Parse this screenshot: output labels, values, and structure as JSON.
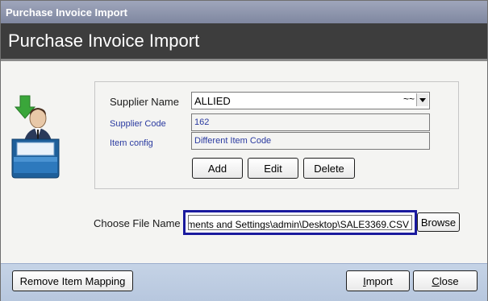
{
  "window": {
    "title": "Purchase Invoice Import"
  },
  "banner": {
    "heading": "Purchase Invoice Import"
  },
  "supplier": {
    "name_label": "Supplier Name",
    "name_value": "ALLIED",
    "name_suffix": "~~",
    "code_label": "Supplier Code",
    "code_value": "162",
    "item_config_label": "Item config",
    "item_config_value": "Different Item Code"
  },
  "actions": {
    "add_label": "Add",
    "edit_label": "Edit",
    "delete_label": "Delete"
  },
  "file": {
    "label": "Choose File Name",
    "path_visible": "ments and Settings\\admin\\Desktop\\SALE3369.CSV",
    "browse_label": "Browse"
  },
  "footer": {
    "remove_mapping_label": "Remove Item Mapping",
    "import_prefix": "I",
    "import_rest": "mport",
    "close_prefix": "C",
    "close_rest": "lose"
  },
  "icons": {
    "import_icon": "user-inbox-import-icon",
    "dropdown_icon": "chevron-down-icon"
  },
  "colors": {
    "banner_bg": "#3d3d3d",
    "focus_border": "#1a1a9e",
    "field_label_blue": "#2a3aa0",
    "footer_bg": "#c5d3e6"
  }
}
